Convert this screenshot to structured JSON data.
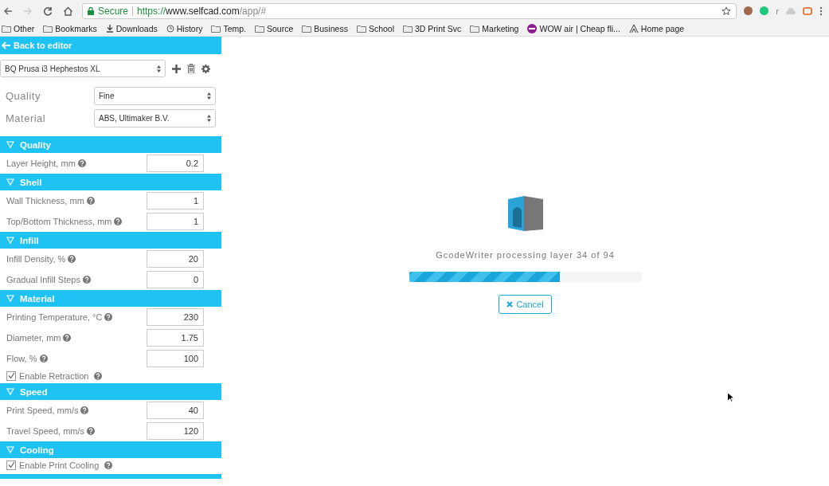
{
  "browser": {
    "secure_label": "Secure",
    "url_scheme": "https://",
    "url_host": "www.selfcad.com",
    "url_path": "/app/#",
    "bookmarks": [
      {
        "label": "Other",
        "kind": "folder"
      },
      {
        "label": "Bookmarks",
        "kind": "folder"
      },
      {
        "label": "Downloads",
        "kind": "download"
      },
      {
        "label": "History",
        "kind": "history"
      },
      {
        "label": "Temp.",
        "kind": "folder"
      },
      {
        "label": "Source",
        "kind": "folder"
      },
      {
        "label": "Business",
        "kind": "folder"
      },
      {
        "label": "School",
        "kind": "folder"
      },
      {
        "label": "3D Print Svc",
        "kind": "folder"
      },
      {
        "label": "Marketing",
        "kind": "folder"
      },
      {
        "label": "WOW air | Cheap fli...",
        "kind": "site"
      },
      {
        "label": "Home page",
        "kind": "page"
      }
    ],
    "extension_letter": "r"
  },
  "sidebar": {
    "back_label": "Back to editor",
    "printer": "BQ Prusa i3 Hephestos XL",
    "quality_label": "Quality",
    "quality_value": "Fine",
    "material_label": "Material",
    "material_value": "ABS, Ultimaker B.V.",
    "sections": [
      {
        "title": "Quality",
        "rows": [
          {
            "kind": "field",
            "label": "Layer Height, mm",
            "value": "0.2"
          }
        ]
      },
      {
        "title": "Shell",
        "rows": [
          {
            "kind": "field",
            "label": "Wall Thickness, mm",
            "value": "1"
          },
          {
            "kind": "field",
            "label": "Top/Bottom Thickness, mm",
            "value": "1"
          }
        ]
      },
      {
        "title": "Infill",
        "rows": [
          {
            "kind": "field",
            "label": "Infill Density, %",
            "value": "20"
          },
          {
            "kind": "field",
            "label": "Gradual Infill Steps",
            "value": "0"
          }
        ]
      },
      {
        "title": "Material",
        "rows": [
          {
            "kind": "field",
            "label": "Printing Temperature, °C",
            "value": "230"
          },
          {
            "kind": "field",
            "label": "Diameter, mm",
            "value": "1.75"
          },
          {
            "kind": "field",
            "label": "Flow, %",
            "value": "100"
          },
          {
            "kind": "checkbox",
            "label": "Enable Retraction",
            "checked": true
          }
        ]
      },
      {
        "title": "Speed",
        "rows": [
          {
            "kind": "field",
            "label": "Print Speed, mm/s",
            "value": "40"
          },
          {
            "kind": "field",
            "label": "Travel Speed, mm/s",
            "value": "120"
          }
        ]
      },
      {
        "title": "Cooling",
        "rows": [
          {
            "kind": "checkbox",
            "label": "Enable Print Cooling",
            "checked": true
          }
        ]
      }
    ]
  },
  "progress": {
    "message": "GcodeWriter processing layer 34 of 94",
    "level": 0.65,
    "cancel_label": "Cancel"
  }
}
